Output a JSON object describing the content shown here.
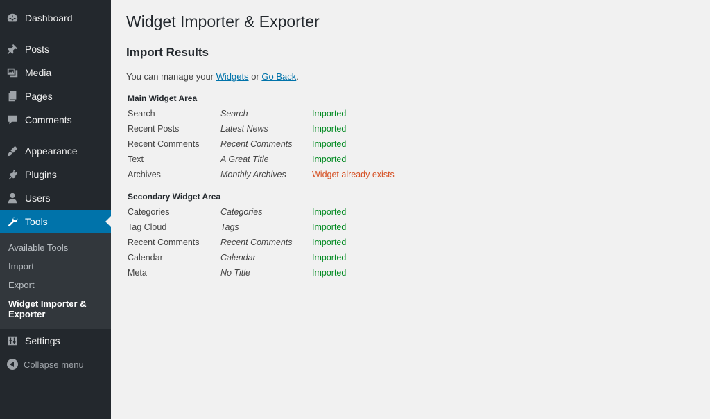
{
  "sidebar": {
    "items": [
      {
        "label": "Dashboard",
        "icon": "dashboard-icon"
      },
      {
        "label": "Posts",
        "icon": "pin-icon"
      },
      {
        "label": "Media",
        "icon": "media-icon"
      },
      {
        "label": "Pages",
        "icon": "pages-icon"
      },
      {
        "label": "Comments",
        "icon": "comment-icon"
      },
      {
        "label": "Appearance",
        "icon": "brush-icon"
      },
      {
        "label": "Plugins",
        "icon": "plug-icon"
      },
      {
        "label": "Users",
        "icon": "user-icon"
      },
      {
        "label": "Tools",
        "icon": "wrench-icon",
        "active": true
      },
      {
        "label": "Settings",
        "icon": "settings-icon"
      }
    ],
    "submenu": [
      "Available Tools",
      "Import",
      "Export",
      "Widget Importer & Exporter"
    ],
    "submenu_current": "Widget Importer & Exporter",
    "collapse_label": "Collapse menu"
  },
  "main": {
    "title": "Widget Importer & Exporter",
    "section_title": "Import Results",
    "intro_before": "You can manage your ",
    "widgets_link": "Widgets",
    "intro_middle": " or ",
    "go_back_link": "Go Back",
    "intro_after": "."
  },
  "areas": [
    {
      "title": "Main Widget Area",
      "rows": [
        {
          "widget": "Search",
          "title": "Search",
          "status": "Imported",
          "status_type": "ok"
        },
        {
          "widget": "Recent Posts",
          "title": "Latest News",
          "status": "Imported",
          "status_type": "ok"
        },
        {
          "widget": "Recent Comments",
          "title": "Recent Comments",
          "status": "Imported",
          "status_type": "ok"
        },
        {
          "widget": "Text",
          "title": "A Great Title",
          "status": "Imported",
          "status_type": "ok"
        },
        {
          "widget": "Archives",
          "title": "Monthly Archives",
          "status": "Widget already exists",
          "status_type": "warn"
        }
      ]
    },
    {
      "title": "Secondary Widget Area",
      "rows": [
        {
          "widget": "Categories",
          "title": "Categories",
          "status": "Imported",
          "status_type": "ok"
        },
        {
          "widget": "Tag Cloud",
          "title": "Tags",
          "status": "Imported",
          "status_type": "ok"
        },
        {
          "widget": "Recent Comments",
          "title": "Recent Comments",
          "status": "Imported",
          "status_type": "ok"
        },
        {
          "widget": "Calendar",
          "title": "Calendar",
          "status": "Imported",
          "status_type": "ok"
        },
        {
          "widget": "Meta",
          "title": "No Title",
          "status": "Imported",
          "status_type": "ok"
        }
      ]
    }
  ],
  "colors": {
    "sidebar_bg": "#23282d",
    "active_bg": "#0073aa",
    "submenu_bg": "#32373c",
    "success": "#008a20",
    "warning": "#d54e21",
    "link": "#0073aa"
  }
}
